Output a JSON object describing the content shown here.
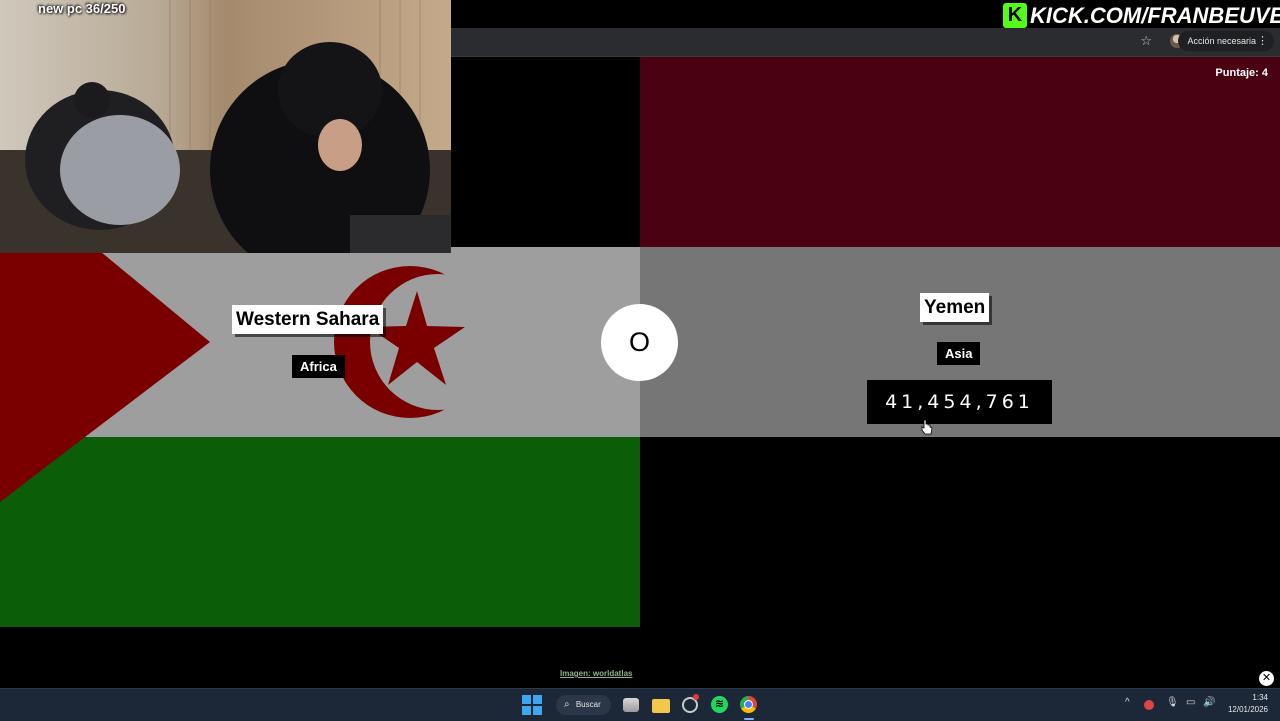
{
  "stream": {
    "webcam_label": "new pc 36/250",
    "kick_logo": "K",
    "kick_url": "KICK.COM/FRANBEUVE"
  },
  "browser": {
    "action_label": "Acción necesaria",
    "menu_glyph": "⋮",
    "star_glyph": "☆"
  },
  "game": {
    "score": "Puntaje: 4",
    "vs": "O",
    "left": {
      "country": "Western Sahara",
      "continent": "Africa",
      "flag_colors": {
        "red": "#7a0000",
        "white": "#9e9e9e",
        "green": "#0b5d07"
      }
    },
    "right": {
      "country": "Yemen",
      "continent": "Asia",
      "population": "41,454,761",
      "flag_colors": {
        "red": "#4a0112",
        "white": "#767676",
        "black": "#000000"
      }
    },
    "image_credit": "Imagen: worldatlas"
  },
  "overlay": {
    "close_glyph": "✕"
  },
  "taskbar": {
    "search_label": "Buscar",
    "search_glyph": "⌕",
    "spotify_glyph": "≋",
    "tray_up": "^",
    "tray_mic": "🎙",
    "tray_monitor": "▭",
    "tray_speaker": "🔊",
    "time": "1:34",
    "date": "12/01/2026"
  }
}
